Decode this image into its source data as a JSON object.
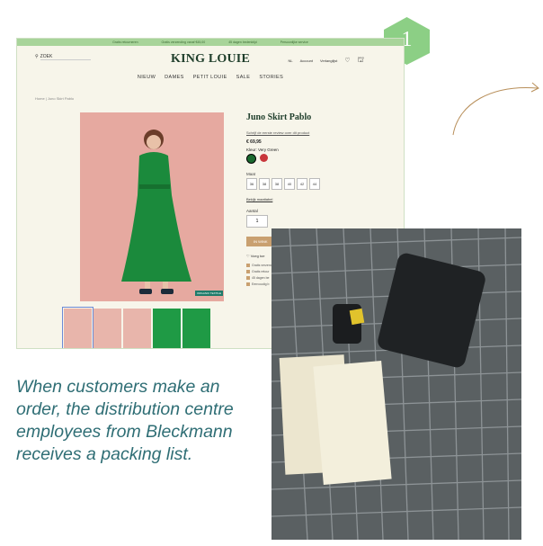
{
  "number_badge": "1",
  "topbar_items": [
    "Gratis retourneren",
    "Gratis verzending vanaf €45,00",
    "45 dagen bedenktijd",
    "Persoonlijke service"
  ],
  "site": {
    "search_label": "ZOEK",
    "logo": "KING LOUIE",
    "lang": "NL",
    "account": "Account",
    "wishlist": "Verlanglijst",
    "nav": [
      "NIEUW",
      "DAMES",
      "PETIT LOUIE",
      "SALE",
      "STORIES"
    ],
    "breadcrumb": "Home  |  Juno Skirt Pablo"
  },
  "product": {
    "title": "Juno Skirt Pablo",
    "review_link": "Schrijf de eerste review over dit product",
    "price": "€ 69,95",
    "color_label": "Kleur: Very Green",
    "colors": [
      "#1b6a2f",
      "#c8363b"
    ],
    "size_label": "Maat",
    "sizes": [
      "36",
      "38",
      "38",
      "40",
      "42",
      "44"
    ],
    "size_guide": "Bekijk maattabel",
    "qty_label": "Aantal",
    "qty_value": "1",
    "cart_button": "IN WINK",
    "wishlist_text": "Voeg toe",
    "new_badge": "ORGANIC TEXTILE",
    "bullets": [
      "Gratis verzend",
      "Gratis retour",
      "45 dagen be",
      "Eenvoudig b"
    ]
  },
  "caption": "When customers make an order, the distribution centre employees from Bleckmann receives a packing list."
}
